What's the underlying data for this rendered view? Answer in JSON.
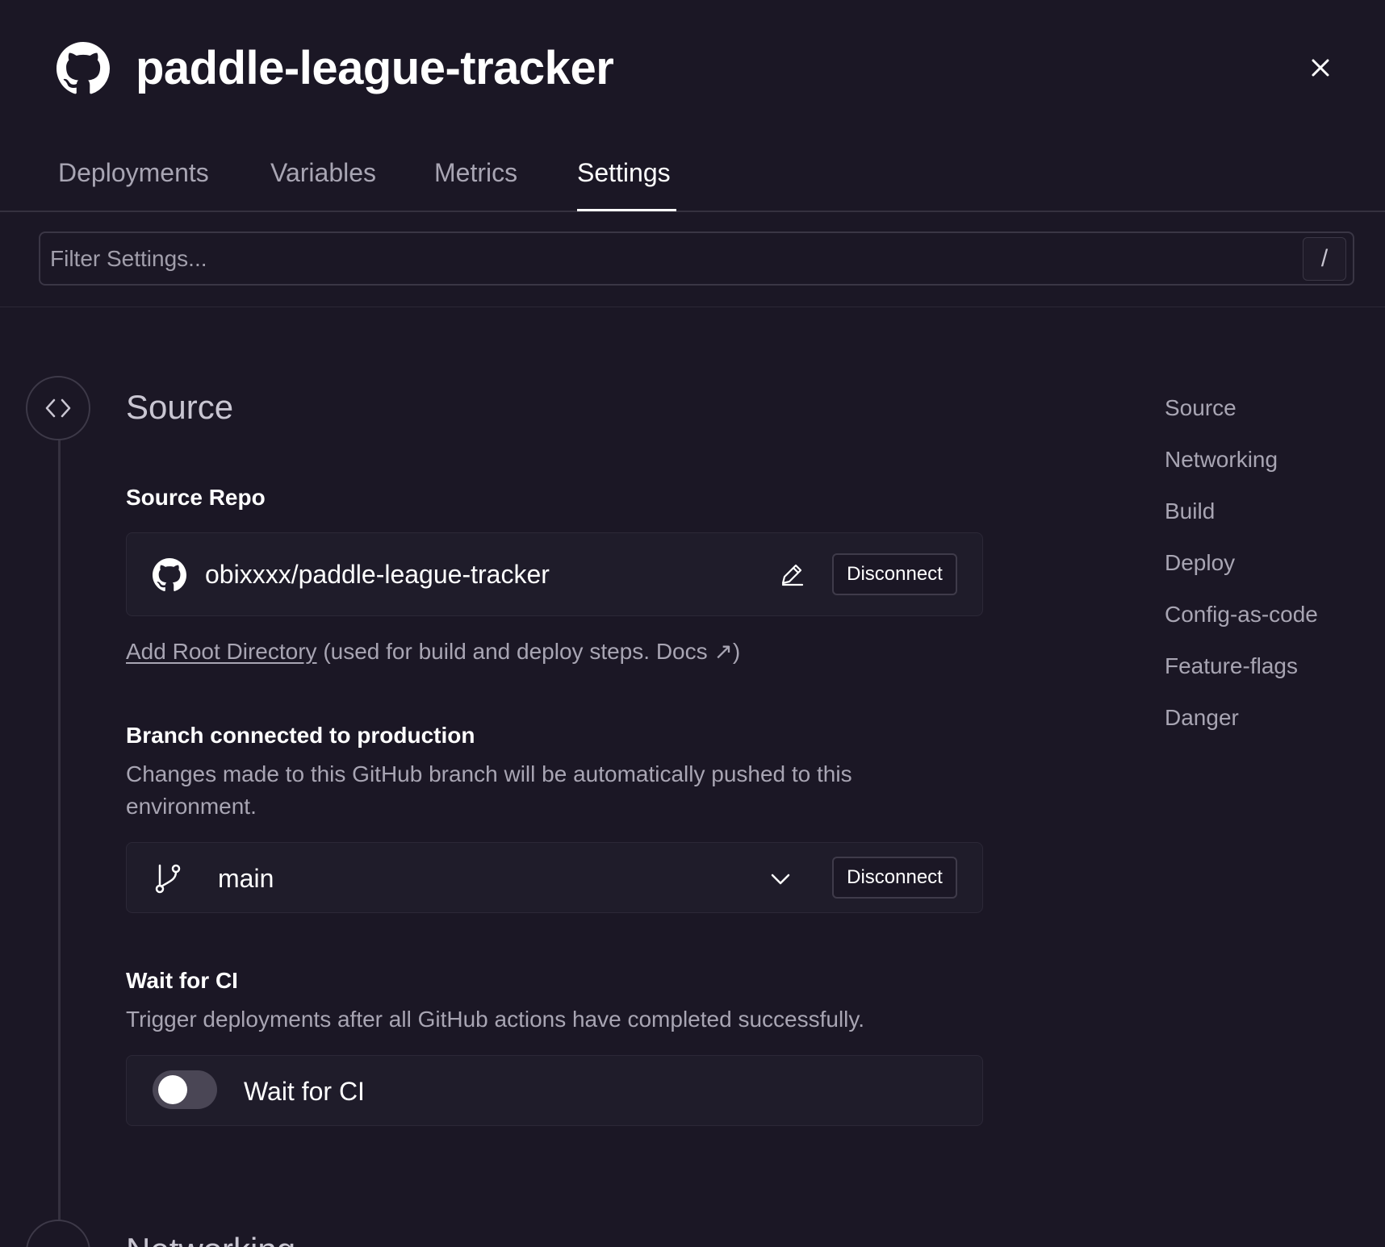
{
  "header": {
    "title": "paddle-league-tracker",
    "logo_icon": "github-icon",
    "close_icon": "close-icon"
  },
  "tabs": [
    {
      "label": "Deployments",
      "active": false
    },
    {
      "label": "Variables",
      "active": false
    },
    {
      "label": "Metrics",
      "active": false
    },
    {
      "label": "Settings",
      "active": true
    }
  ],
  "filter": {
    "placeholder": "Filter Settings...",
    "value": "",
    "shortcut": "/"
  },
  "section": {
    "title": "Source",
    "icon": "code-icon",
    "source_repo": {
      "label": "Source Repo",
      "repo": "obixxxx/paddle-league-tracker",
      "edit_icon": "pencil-icon",
      "disconnect_label": "Disconnect"
    },
    "root_dir": {
      "link_label": "Add Root Directory",
      "note_prefix": "(used for build and deploy steps.",
      "docs_label": "Docs ↗",
      "note_suffix": ")"
    },
    "branch": {
      "label": "Branch connected to production",
      "description": "Changes made to this GitHub branch will be automatically pushed to this environment.",
      "value": "main",
      "branch_icon": "git-branch-icon",
      "dropdown_icon": "chevron-down-icon",
      "disconnect_label": "Disconnect"
    },
    "wait_ci": {
      "label": "Wait for CI",
      "description": "Trigger deployments after all GitHub actions have completed successfully.",
      "toggle_label": "Wait for CI",
      "enabled": false
    }
  },
  "next_section": {
    "title": "Networking"
  },
  "right_nav": [
    "Source",
    "Networking",
    "Build",
    "Deploy",
    "Config-as-code",
    "Feature-flags",
    "Danger"
  ],
  "colors": {
    "background": "#1b1725",
    "card": "#1f1c2a",
    "muted_text": "#a8a5b3",
    "border": "#3a3645"
  }
}
